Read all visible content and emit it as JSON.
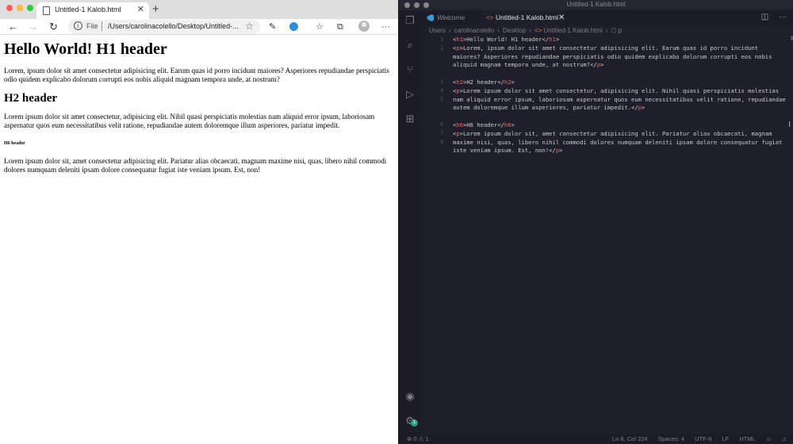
{
  "browser": {
    "tab_title": "Untitled-1 Kalob.html",
    "address_scheme": "File",
    "address_url": "/Users/carolinacolello/Desktop/Untitled-...",
    "page": {
      "h1": "Hello World! H1 header",
      "p1": "Lorem, ipsum dolor sit amet consectetur adipisicing elit. Earum quas id porro incidunt maiores? Asperiores repudiandae perspiciatis odio quidem explicabo dolorum corrupti eos nobis aliquid magnam tempora unde, at nostrum?",
      "h2": "H2 header",
      "p2": "Lorem ipsum dolor sit amet consectetur, adipisicing elit. Nihil quasi perspiciatis molestias nam aliquid error ipsum, laboriosam aspernatur quos eum necessitatibus velit ratione, repudiandae autem doloremque illum asperiores, pariatur impedit.",
      "h6": "H6 header",
      "p3": "Lorem ipsum dolor sit, amet consectetur adipisicing elit. Pariatur alias obcaecati, magnam maxime nisi, quas, libero nihil commodi dolores numquam deleniti ipsam dolore consequatur fugiat iste veniam ipsum. Est, non!"
    }
  },
  "vscode": {
    "window_title": "Untitled-1 Kalob.html",
    "tabs": [
      {
        "label": "Welcome"
      },
      {
        "label": "Untitled-1 Kalob.html"
      }
    ],
    "breadcrumbs": [
      "Users",
      "carolinacolello",
      "Desktop",
      "Untitled-1 Kalob.html",
      "p"
    ],
    "line_numbers": [
      "1",
      "2",
      "3",
      "4",
      "5",
      "6",
      "7",
      "8"
    ],
    "code": {
      "l1_text": "Hello World! H1 header",
      "l2_text": "Lorem, ipsum dolor sit amet consectetur adipisicing elit. Earum quas id porro incidunt maiores? Asperiores repudiandae perspiciatis odio quidem explicabo dolorum corrupti eos nobis aliquid magnam tempora unde, at nostrum?",
      "l4_text": "H2 header",
      "l5_text": "Lorem ipsum dolor sit amet consectetur, adipisicing elit. Nihil quasi perspiciatis molestias nam aliquid error ipsum, laboriosam aspernatur quos eum necessitatibus velit ratione, repudiandae autem doloremque illum asperiores, pariatur impedit.",
      "l7_text": "H6 header",
      "l8_text": "Lorem ipsum dolor sit, amet consectetur adipisicing elit. Pariatur alias obcaecati, magnam maxime nisi, quas, libero nihil commodi dolores numquam deleniti ipsam dolore consequatur fugiat iste veniam ipsum. Est, non!"
    },
    "status": {
      "problems_errors": "0",
      "problems_warnings": "1",
      "cursor": "Ln 8, Col 224",
      "spaces": "Spaces: 4",
      "encoding": "UTF-8",
      "eol": "LF",
      "language": "HTML"
    },
    "account_badge": "1"
  }
}
